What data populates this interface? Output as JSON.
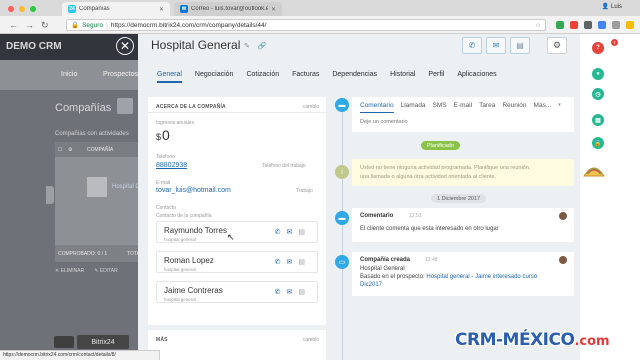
{
  "browser": {
    "tabs": [
      {
        "favicon": "24",
        "title": "Compañías",
        "color": "#2fc6f6"
      },
      {
        "favicon": "✉",
        "title": "Correo - luis.tovar@outlook.es",
        "color": "#0078d4"
      }
    ],
    "user": "Luis",
    "url_secure_label": "Seguro",
    "url": "https://democrm.bitrix24.com/crm/company/details/44/",
    "status_url": "https://democrm.bitrix24.com/crm/contact/details/8/"
  },
  "background": {
    "logo": "DEMO CRM",
    "menu": [
      "Inicio",
      "Prospectos"
    ],
    "page_title": "Compañías",
    "sub_text": "Compañías con actividades",
    "table_header": [
      "☐",
      "⚙",
      "COMPAÑÍA"
    ],
    "row_link": "Hospital G",
    "footer": [
      "COMPROBADO: 0 / 1",
      "TOTAL"
    ],
    "actions": [
      "✕ ELIMINAR",
      "✎ EDITAR"
    ],
    "bitrix_label": "Bitrix24"
  },
  "panel": {
    "title": "Hospital General",
    "tabs": [
      "General",
      "Negociación",
      "Cotización",
      "Facturas",
      "Dependencias",
      "Historial",
      "Perfil",
      "Aplicaciones"
    ],
    "active_tab": "General"
  },
  "about": {
    "heading": "ACERCA DE LA COMPAÑÍA",
    "change": "cambio",
    "revenue_label": "Ingresos anuales",
    "currency": "$",
    "revenue": "0",
    "phone_label": "Teléfono",
    "phone": "88802938",
    "phone_type": "Teléfono del trabajo",
    "email_label": "E-mail",
    "email": "tovar_luis@hotmail.com",
    "email_type": "Trabajo",
    "contact_label": "Contacto",
    "contact_sub": "Contacto de la compañía",
    "contacts": [
      {
        "name": "Raymundo Torres",
        "role": "hospital general"
      },
      {
        "name": "Roman Lopez",
        "role": "hospital general"
      },
      {
        "name": "Jaime Contreras",
        "role": "hospital general"
      }
    ]
  },
  "more": {
    "heading": "MÁS",
    "change": "cambio"
  },
  "timeline": {
    "composer_tabs": [
      "Comentario",
      "Llamada",
      "SMS",
      "E-mail",
      "Tarea",
      "Reunión",
      "Más..."
    ],
    "composer_placeholder": "Deje un comentario",
    "planned": "Planificado",
    "warning_line1": "Usted no tiene ninguna actividad programada. Planifique una reunión,",
    "warning_line2": "una llamada o alguna otra actividad orientada al cliente.",
    "date": "1 Diciembre 2017",
    "comment_title": "Comentario",
    "comment_time": "12:51",
    "comment_text": "El cliente comenta que esta interesado en otro lugar",
    "created_title": "Compañía creada",
    "created_time": "12:48",
    "created_name": "Hospital General",
    "created_prefix": "Basado en el prospecto: ",
    "created_link_1": "Hospital general - Jaime interesado curso",
    "created_link_2": "Dic2017"
  },
  "rail_badges": {
    "top": "7"
  },
  "watermark": {
    "main": "CRM-MÉXICO",
    "suffix": ".com"
  },
  "colors": {
    "accent": "#2067b0",
    "planned": "#8bc34a",
    "rail_green": "#25b892",
    "rail_red": "#e5443b"
  }
}
